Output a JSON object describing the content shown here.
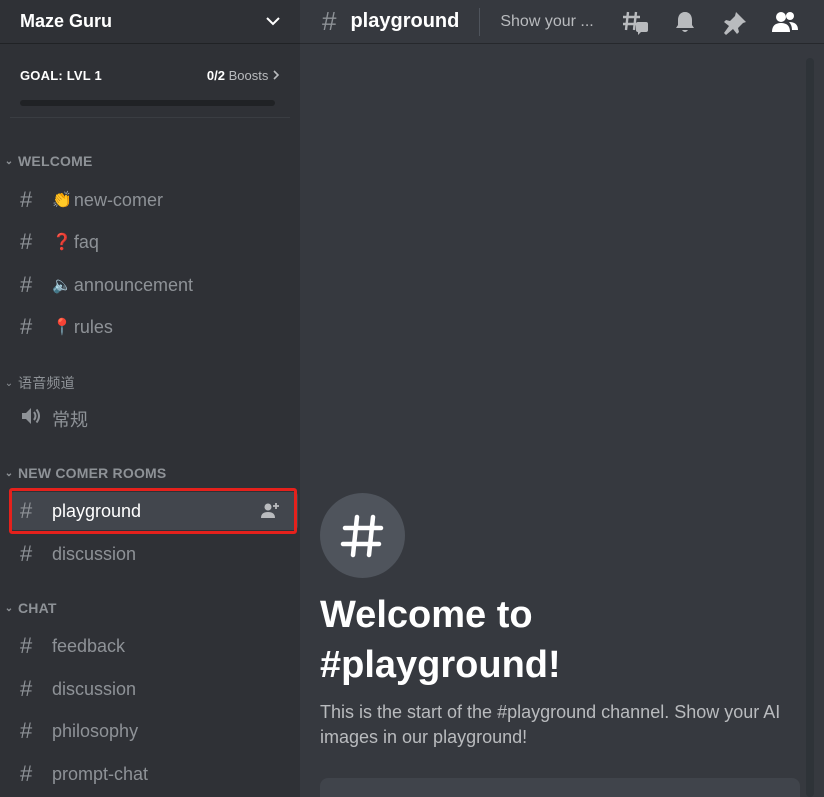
{
  "server": {
    "name": "Maze Guru"
  },
  "goal": {
    "title": "GOAL: LVL 1",
    "count": "0/2",
    "boosts_label": "Boosts",
    "progress": 0
  },
  "categories": [
    {
      "name": "WELCOME",
      "channels": [
        {
          "emoji": "👏",
          "name": "new-comer"
        },
        {
          "emoji": "❓",
          "name": "faq"
        },
        {
          "emoji": "🔈",
          "name": "announcement"
        },
        {
          "emoji": "📍",
          "name": "rules"
        }
      ]
    },
    {
      "name": "语音频道",
      "channels": [
        {
          "name": "常规",
          "type": "voice"
        }
      ]
    },
    {
      "name": "NEW COMER ROOMS",
      "channels": [
        {
          "name": "playground",
          "active": true
        },
        {
          "name": "discussion"
        }
      ]
    },
    {
      "name": "CHAT",
      "channels": [
        {
          "name": "feedback"
        },
        {
          "name": "discussion"
        },
        {
          "name": "philosophy"
        },
        {
          "name": "prompt-chat"
        }
      ]
    }
  ],
  "header": {
    "channel": "playground",
    "topic": "Show your ..."
  },
  "welcome": {
    "title_line1": "Welcome to",
    "title_line2": "#playground!",
    "description": "This is the start of the #playground channel. Show your AI images in our playground!"
  },
  "colors": {
    "highlight": "#e5211c",
    "sidebar": "#2f3136",
    "main": "#36393f"
  }
}
